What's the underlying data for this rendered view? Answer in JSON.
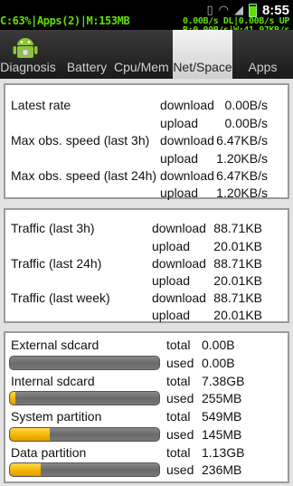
{
  "status_bar": {
    "left_text": "C:63%|Apps(2)|M:153MB",
    "net_line1": "0.00B/s DL|0.00B/s UP",
    "net_line2": "R:0.00B/s|W:41.97KB/s",
    "clock": "8:55",
    "icons": [
      "vibrate-icon",
      "wifi-icon",
      "signal-icon",
      "battery-icon"
    ]
  },
  "tabs": [
    {
      "label": "Diagnosis",
      "active": false
    },
    {
      "label": "Battery",
      "active": false
    },
    {
      "label": "Cpu/Mem",
      "active": false
    },
    {
      "label": "Net/Space",
      "active": true
    },
    {
      "label": "Apps",
      "active": false
    }
  ],
  "rates": {
    "rows": [
      {
        "label": "Latest rate",
        "dl_label": "download",
        "dl_value": "0.00B/s",
        "ul_label": "upload",
        "ul_value": "0.00B/s"
      },
      {
        "label": "Max obs. speed (last 3h)",
        "dl_label": "download",
        "dl_value": "6.47KB/s",
        "ul_label": "upload",
        "ul_value": "1.20KB/s"
      },
      {
        "label": "Max obs. speed (last 24h)",
        "dl_label": "download",
        "dl_value": "6.47KB/s",
        "ul_label": "upload",
        "ul_value": "1.20KB/s"
      }
    ]
  },
  "traffic": {
    "rows": [
      {
        "label": "Traffic (last 3h)",
        "dl_label": "download",
        "dl_value": "88.71KB",
        "ul_label": "upload",
        "ul_value": "20.01KB"
      },
      {
        "label": "Traffic (last 24h)",
        "dl_label": "download",
        "dl_value": "88.71KB",
        "ul_label": "upload",
        "ul_value": "20.01KB"
      },
      {
        "label": "Traffic (last week)",
        "dl_label": "download",
        "dl_value": "88.71KB",
        "ul_label": "upload",
        "ul_value": "20.01KB"
      }
    ]
  },
  "storage": {
    "rows": [
      {
        "label": "External sdcard",
        "total_label": "total",
        "total": "0.00B",
        "used_label": "used",
        "used": "0.00B",
        "used_fraction": 0.0
      },
      {
        "label": "Internal sdcard",
        "total_label": "total",
        "total": "7.38GB",
        "used_label": "used",
        "used": "255MB",
        "used_fraction": 0.034
      },
      {
        "label": "System partition",
        "total_label": "total",
        "total": "549MB",
        "used_label": "used",
        "used": "145MB",
        "used_fraction": 0.264
      },
      {
        "label": "Data partition",
        "total_label": "total",
        "total": "1.13GB",
        "used_label": "used",
        "used": "236MB",
        "used_fraction": 0.204
      }
    ]
  },
  "colors": {
    "status_green": "#5fe000",
    "bar_fill": "#f2b300",
    "bar_track": "#777777"
  }
}
